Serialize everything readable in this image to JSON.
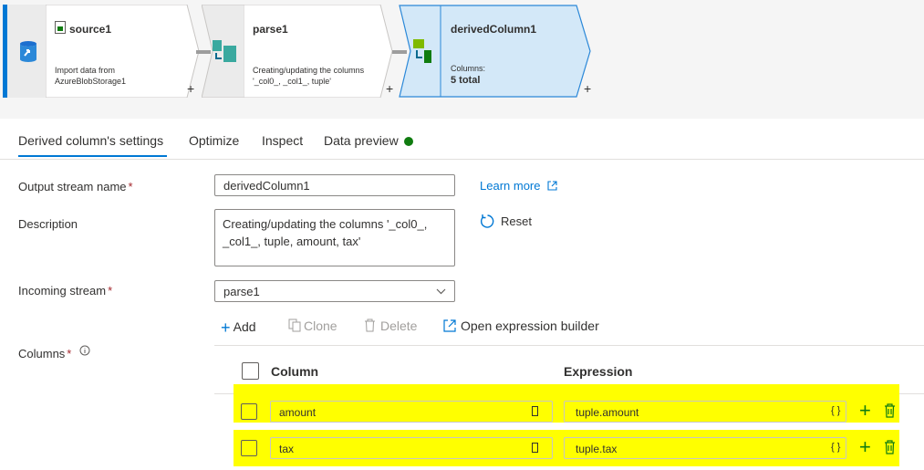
{
  "pipeline": {
    "nodes": [
      {
        "title": "source1",
        "desc_lines": [
          "Import data from",
          "AzureBlobStorage1"
        ]
      },
      {
        "title": "parse1",
        "desc_lines": [
          "Creating/updating the columns",
          "'_col0_, _col1_, tuple'"
        ]
      },
      {
        "title": "derivedColumn1",
        "desc_lines": [
          "Columns:"
        ],
        "count": "5 total"
      }
    ],
    "add_symbol": "+"
  },
  "tabs": [
    {
      "label": "Derived column's settings",
      "active": true
    },
    {
      "label": "Optimize",
      "active": false
    },
    {
      "label": "Inspect",
      "active": false
    },
    {
      "label": "Data preview",
      "active": false,
      "status": "green-dot"
    }
  ],
  "form": {
    "output_stream": {
      "label": "Output stream name",
      "value": "derivedColumn1"
    },
    "learn_more": "Learn more",
    "description": {
      "label": "Description",
      "value": "Creating/updating the columns '_col0_, _col1_, tuple, amount, tax'"
    },
    "reset": "Reset",
    "incoming_stream": {
      "label": "Incoming stream",
      "value": "parse1"
    },
    "columns_label": "Columns",
    "required_mark": "*"
  },
  "toolbar": {
    "add": "Add",
    "clone": "Clone",
    "delete": "Delete",
    "open_builder": "Open expression builder"
  },
  "table": {
    "headers": {
      "column": "Column",
      "expression": "Expression"
    },
    "rows": [
      {
        "column": "amount",
        "expression": "tuple.amount",
        "highlighted": true
      },
      {
        "column": "tax",
        "expression": "tuple.tax",
        "highlighted": true
      }
    ],
    "expr_icon": "{ }"
  },
  "colors": {
    "accent": "#0078d4",
    "highlight": "#ffff00",
    "success": "#107c10",
    "required": "#a4262c"
  }
}
